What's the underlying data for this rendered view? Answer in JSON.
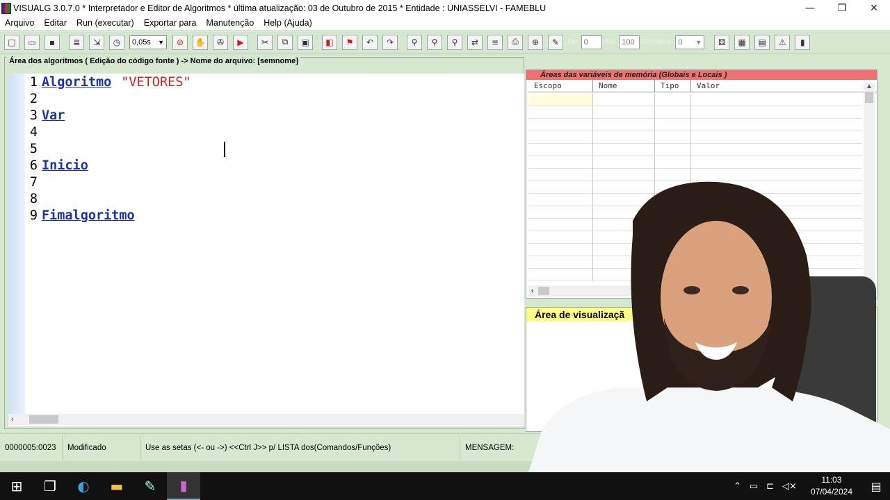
{
  "window": {
    "title": "VISUALG 3.0.7.0 * Interpretador e Editor de Algoritmos * última atualização: 03 de Outubro de 2015 * Entidade : UNIASSELVI - FAMEBLU",
    "minimize": "—",
    "restore": "❐",
    "close": "✕"
  },
  "menu": [
    "Arquivo",
    "Editar",
    "Run (executar)",
    "Exportar para",
    "Manutenção",
    "Help (Ajuda)"
  ],
  "toolbar": {
    "speed_value": "0,05s",
    "de_label": "De:",
    "de_value": "0",
    "ate_label": "Até:",
    "ate_value": "100",
    "decimais_label": "Decimais:",
    "decimais_value": "0"
  },
  "editor": {
    "header": "Área dos algoritmos ( Edição do código fonte ) -> Nome do arquivo: [semnome]",
    "lines": [
      {
        "num": "1",
        "keyword": "Algoritmo",
        "string": "\"VETORES\""
      },
      {
        "num": "2",
        "keyword": "",
        "string": ""
      },
      {
        "num": "3",
        "keyword": "Var",
        "string": ""
      },
      {
        "num": "4",
        "keyword": "",
        "string": ""
      },
      {
        "num": "5",
        "keyword": "",
        "string": ""
      },
      {
        "num": "6",
        "keyword": "Inicio",
        "string": ""
      },
      {
        "num": "7",
        "keyword": "",
        "string": ""
      },
      {
        "num": "8",
        "keyword": "",
        "string": ""
      },
      {
        "num": "9",
        "keyword": "Fimalgoritmo",
        "string": ""
      }
    ]
  },
  "variables": {
    "title": "Áreas das variáveis de memória (Globais e Locais )",
    "columns": [
      "Escopo",
      "Nome",
      "Tipo",
      "Valor"
    ]
  },
  "visualization": {
    "title": "Área de visualizaçã"
  },
  "status": {
    "position": "0000005:0023",
    "state": "Modificado",
    "hint": "Use as setas (<- ou ->) <<Ctrl J>> p/ LISTA dos(Comandos/Funções)",
    "message_label": "MENSAGEM:"
  },
  "taskbar": {
    "time": "11:03",
    "date": "07/04/2024"
  }
}
